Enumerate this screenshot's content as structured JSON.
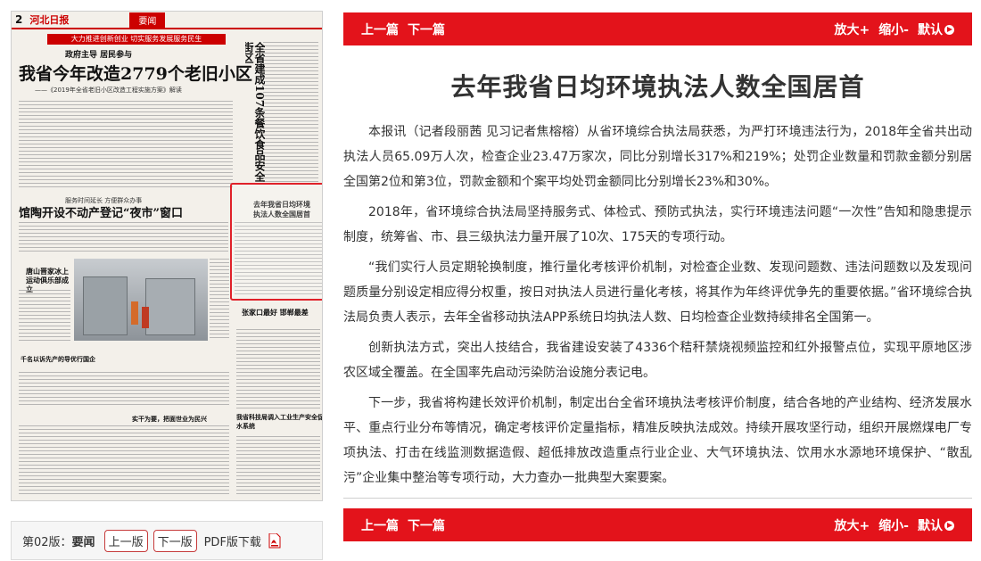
{
  "thumbnail": {
    "page_num": "2",
    "paper_name": "河北日报",
    "section": "要闻",
    "band": "大力推进创新创业 切实服务发展服务民生",
    "sub": "政府主导 居民参与",
    "big_title": "我省今年改造2779个老旧小区",
    "note": "——《2019年全省老旧小区改造工程实施方案》解读",
    "vert_title": "全省建成107条餐饮食品安全街区",
    "mid1": "服务时间延长 方便群众办事",
    "mid2": "馆陶开设不动产登记“夜市”窗口",
    "box_title": "去年我省日均环境执法人数全国居首",
    "side_title": "唐山晋家冰上运动俱乐部成立",
    "hl1": "张家口最好 邯郸最差",
    "hl2": "千名以诉先产的导优行国企",
    "hl3": "实干为要，把面世业为民兴",
    "hl4": "我省科技局调入工业生产安全促水系统"
  },
  "page_nav": {
    "section_prefix": "第02版：",
    "section_name": "要闻",
    "prev": "上一版",
    "next": "下一版",
    "pdf": "PDF版下载"
  },
  "toolbar": {
    "prev_article": "上一篇",
    "next_article": "下一篇",
    "zoom_in": "放大+",
    "zoom_out": "缩小-",
    "reset": "默认"
  },
  "article": {
    "title": "去年我省日均环境执法人数全国居首",
    "paragraphs": [
      "本报讯（记者段丽茜 见习记者焦榕榕）从省环境综合执法局获悉，为严打环境违法行为，2018年全省共出动执法人员65.09万人次，检查企业23.47万家次，同比分别增长317%和219%；处罚企业数量和罚款金额分别居全国第2位和第3位，罚款金额和个案平均处罚金额同比分别增长23%和30%。",
      "2018年，省环境综合执法局坚持服务式、体检式、预防式执法，实行环境违法问题“一次性”告知和隐患提示制度，统筹省、市、县三级执法力量开展了10次、175天的专项行动。",
      "“我们实行人员定期轮换制度，推行量化考核评价机制，对检查企业数、发现问题数、违法问题数以及发现问题质量分别设定相应得分权重，按日对执法人员进行量化考核，将其作为年终评优争先的重要依据。”省环境综合执法局负责人表示，去年全省移动执法APP系统日均执法人数、日均检查企业数持续排名全国第一。",
      "创新执法方式，突出人技结合，我省建设安装了4336个秸秆禁烧视频监控和红外报警点位，实现平原地区涉农区域全覆盖。在全国率先启动污染防治设施分表记电。",
      "下一步，我省将构建长效评价机制，制定出台全省环境执法考核评价制度，结合各地的产业结构、经济发展水平、重点行业分布等情况，确定考核评价定量指标，精准反映执法成效。持续开展攻坚行动，组织开展燃煤电厂专项执法、打击在线监测数据造假、超低排放改造重点行业企业、大气环境执法、饮用水水源地环境保护、“散乱污”企业集中整治等专项行动，大力查办一批典型大案要案。"
    ]
  },
  "colors": {
    "accent": "#e3131b",
    "text": "#333333"
  }
}
